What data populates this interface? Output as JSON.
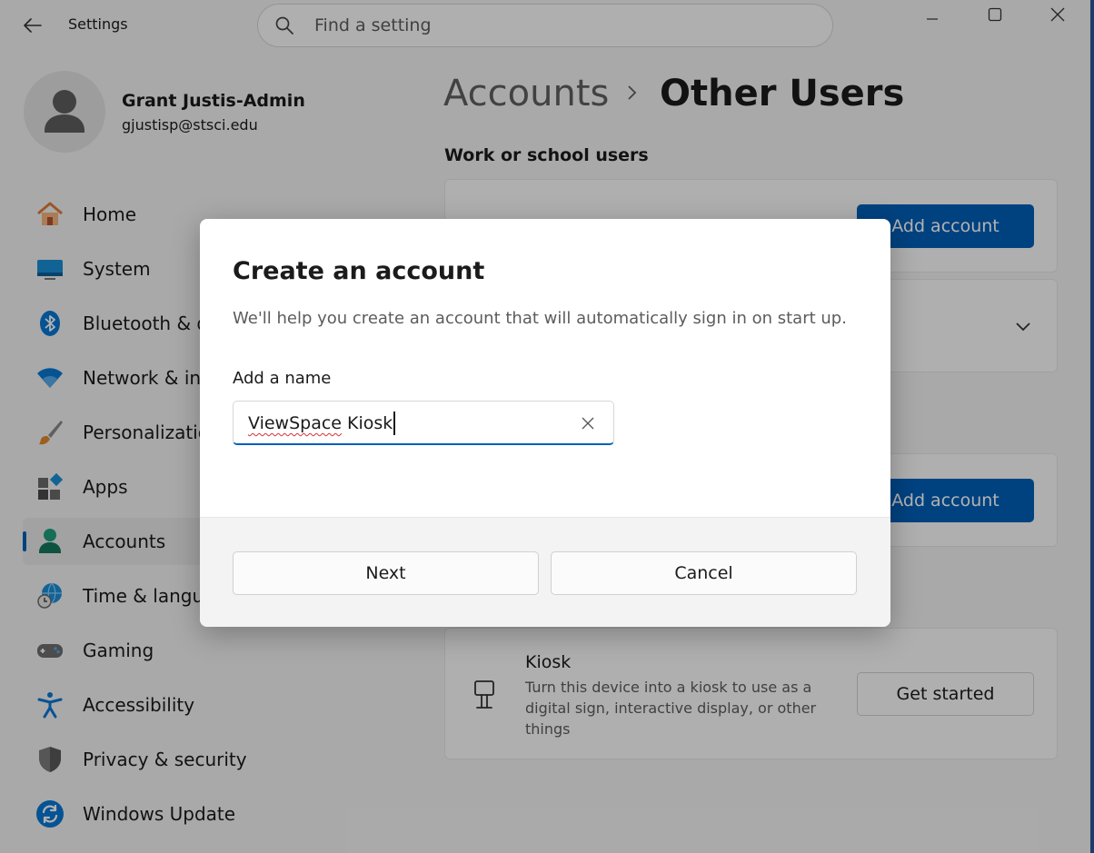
{
  "window": {
    "app_title": "Settings",
    "search_placeholder": "Find a setting"
  },
  "profile": {
    "name": "Grant Justis-Admin",
    "email": "gjustisp@stsci.edu"
  },
  "sidebar": {
    "items": [
      {
        "label": "Home",
        "icon": "home-icon"
      },
      {
        "label": "System",
        "icon": "system-icon"
      },
      {
        "label": "Bluetooth & d",
        "icon": "bluetooth-icon"
      },
      {
        "label": "Network & int",
        "icon": "wifi-icon"
      },
      {
        "label": "Personalizatio",
        "icon": "brush-icon"
      },
      {
        "label": "Apps",
        "icon": "apps-icon"
      },
      {
        "label": "Accounts",
        "icon": "accounts-icon",
        "active": true
      },
      {
        "label": "Time & langua",
        "icon": "globe-clock-icon"
      },
      {
        "label": "Gaming",
        "icon": "gamepad-icon"
      },
      {
        "label": "Accessibility",
        "icon": "accessibility-icon"
      },
      {
        "label": "Privacy & security",
        "icon": "shield-icon"
      },
      {
        "label": "Windows Update",
        "icon": "update-icon"
      }
    ]
  },
  "main": {
    "breadcrumb_parent": "Accounts",
    "breadcrumb_current": "Other Users",
    "work_section_title": "Work or school users",
    "add_account_label_1": "Add account",
    "add_account_label_2": "Add account",
    "kiosk": {
      "title": "Kiosk",
      "description": "Turn this device into a kiosk to use as a digital sign, interactive display, or other things",
      "button_label": "Get started"
    }
  },
  "dialog": {
    "title": "Create an account",
    "description": "We'll help you create an account that will automatically sign in on start up.",
    "field_label": "Add a name",
    "name_value_word1": "ViewSpace",
    "name_value_rest": " Kiosk",
    "next_label": "Next",
    "cancel_label": "Cancel"
  },
  "colors": {
    "accent": "#005fb8",
    "spellcheck": "#d13438"
  }
}
